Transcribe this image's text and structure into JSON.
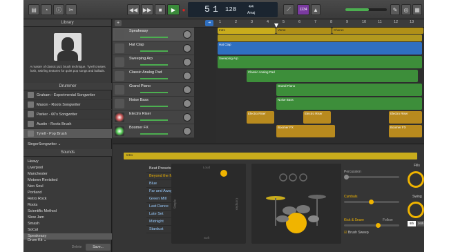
{
  "colors": {
    "accent": "#f0b400",
    "blue": "#2f6fc0",
    "green": "#3d8e3a",
    "gold": "#b88a1e",
    "yellow": "#c9ac1c"
  },
  "toolbar": {
    "icons": [
      "library-icon",
      "smart-controls-icon",
      "info-icon",
      "scissors-icon"
    ],
    "transport": [
      "rewind-icon",
      "fast-forward-icon",
      "stop-icon",
      "play-icon",
      "record-icon",
      "cycle-icon"
    ],
    "lcd": {
      "bar": "5",
      "beat": "1",
      "tempo": "128",
      "sig": "4/4",
      "key": "Amaj"
    },
    "count_in": "1234"
  },
  "library": {
    "title": "Library",
    "description": "A master of classic jazz brush technique, Tyrell creates lush, swirling textures for quiet pop songs and ballads.",
    "drummer_header": "Drummer",
    "drummers": [
      "Graham - Experimental Songwriter",
      "Mason - Roots Songwriter",
      "Parker - 60's Songwriter",
      "Austin - Roots Brush",
      "Tyrell - Pop Brush"
    ],
    "genre": "SingerSongwriter",
    "sounds_header": "Sounds",
    "sounds": [
      "Heavy",
      "Liverpool",
      "Manchester",
      "Motown Revisited",
      "Neo Soul",
      "Portland",
      "Retro Rock",
      "Roots",
      "Scientific Method",
      "Slow Jam",
      "Smash",
      "SoCal",
      "Speakeasy"
    ],
    "kit": "Drum Kit",
    "delete": "Delete",
    "save": "Save..."
  },
  "tracks": [
    "Speakeasy",
    "Hat Clap",
    "Sweeping Arp",
    "Classic Analog Pad",
    "Grand Piano",
    "Noise Bass",
    "Electro Riser",
    "Boomer FX"
  ],
  "ruler": [
    "1",
    "2",
    "3",
    "4",
    "5",
    "6",
    "7",
    "8",
    "9",
    "10",
    "11",
    "12",
    "13"
  ],
  "sections": [
    "Intro",
    "Verse",
    "Chorus"
  ],
  "regions": {
    "hatclap": "Hat Clap",
    "arp": "Sweeping Arp",
    "pad": "Classic Analog Pad",
    "piano": "Grand Piano",
    "bass": "Noise Bass",
    "riser": "Electro Riser",
    "boomer": "Boomer FX"
  },
  "editor": {
    "region": "Intro",
    "presets_header": "Beat Presets",
    "presets": [
      "Beyond the Moon",
      "Blue",
      "Far and Away",
      "Green Mill",
      "Last Dance",
      "Late Set",
      "Midnight",
      "Stardust"
    ],
    "xy": {
      "top": "Loud",
      "bottom": "Soft",
      "left": "Simple",
      "right": "Complex"
    },
    "percussion": "Percussion",
    "cymbals": "Cymbals",
    "kick": "Kick & Snare",
    "follow": "Follow",
    "sweep": "Brush Sweep",
    "fills": "Fills",
    "swing": "Swing",
    "eighth": "8th",
    "sixteenth": "16th"
  }
}
